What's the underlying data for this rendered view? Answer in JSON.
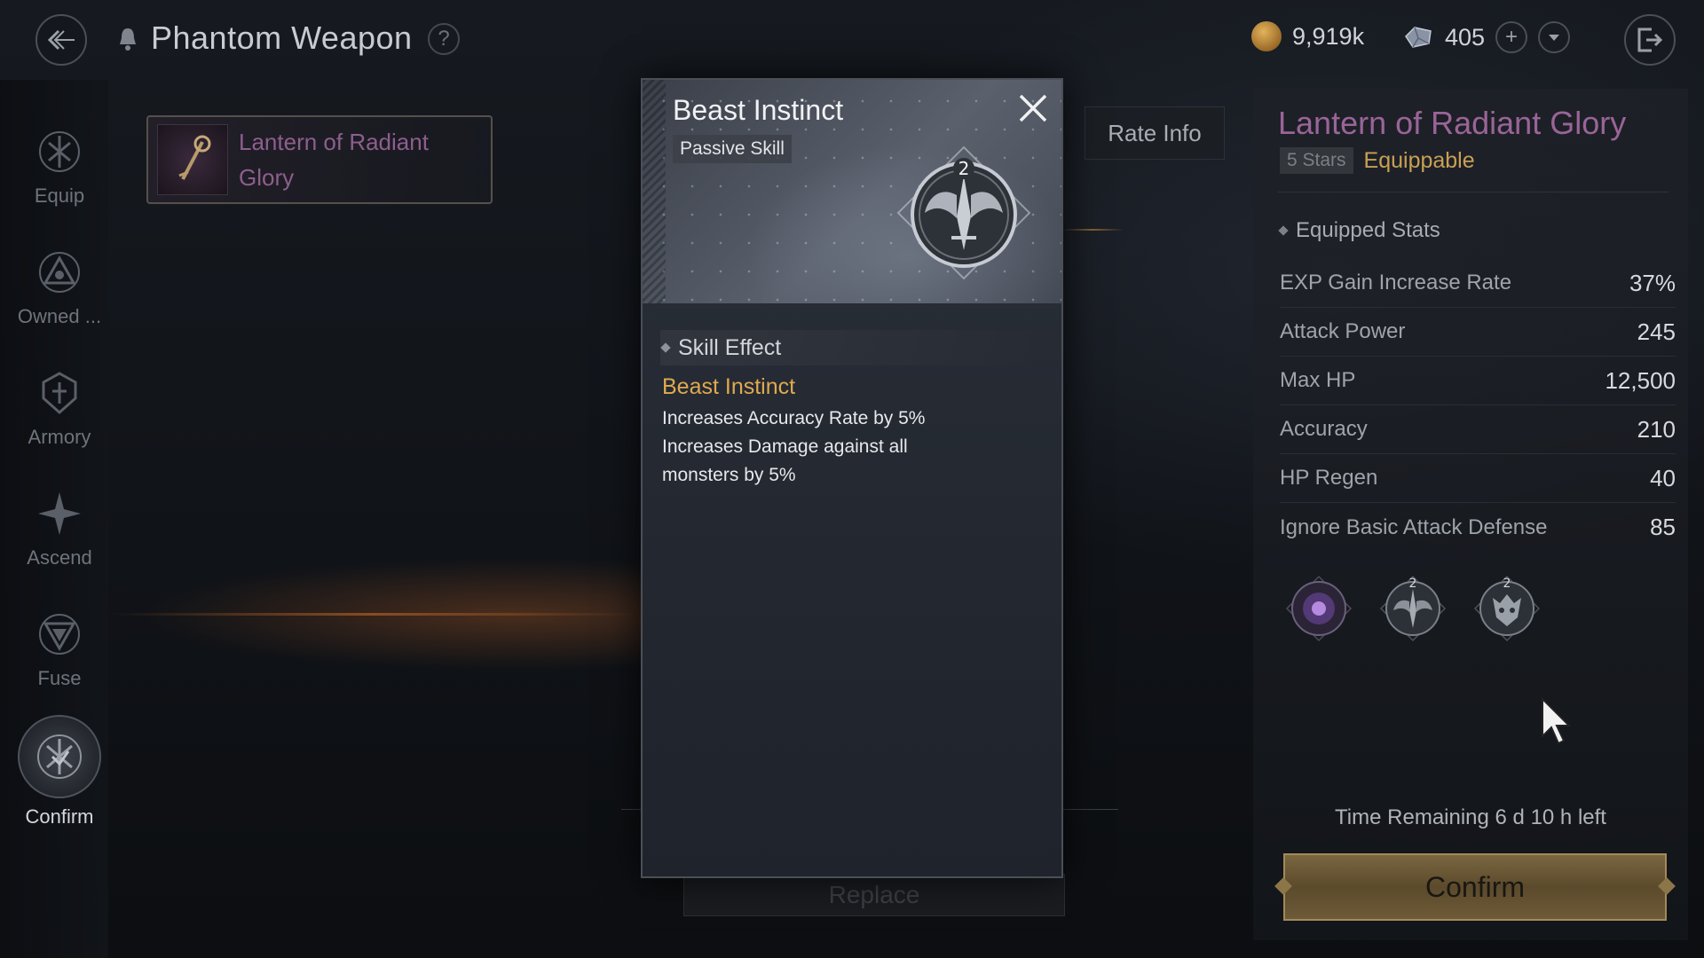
{
  "header": {
    "title": "Phantom Weapon",
    "help": "?",
    "currencies": [
      {
        "icon": "gold-coin-icon",
        "value": "9,919k"
      },
      {
        "icon": "crystal-icon",
        "value": "405"
      }
    ]
  },
  "sidebar": {
    "items": [
      {
        "label": "Equip",
        "icon": "equip-icon"
      },
      {
        "label": "Owned ...",
        "icon": "owned-icon"
      },
      {
        "label": "Armory",
        "icon": "armory-icon"
      },
      {
        "label": "Ascend",
        "icon": "ascend-icon"
      },
      {
        "label": "Fuse",
        "icon": "fuse-icon"
      },
      {
        "label": "Confirm",
        "icon": "confirm-icon",
        "active": true
      }
    ]
  },
  "weapon_card": {
    "name": "Lantern of Radiant Glory"
  },
  "background_button": "Replace",
  "modal": {
    "title": "Beast Instinct",
    "type": "Passive Skill",
    "level": "2",
    "section": "Skill Effect",
    "effect_name": "Beast Instinct",
    "effect_lines": [
      "Increases Accuracy Rate by 5%",
      "Increases Damage against all\nmonsters by 5%"
    ]
  },
  "rate_info": "Rate Info",
  "right_panel": {
    "title": "Lantern of Radiant Glory",
    "stars": "5 Stars",
    "status": "Equippable",
    "section": "Equipped Stats",
    "stats": [
      {
        "name": "EXP Gain Increase Rate",
        "value": "37%"
      },
      {
        "name": "Attack Power",
        "value": "245"
      },
      {
        "name": "Max HP",
        "value": "12,500"
      },
      {
        "name": "Accuracy",
        "value": "210"
      },
      {
        "name": "HP Regen",
        "value": "40"
      },
      {
        "name": "Ignore Basic Attack Defense",
        "value": "85"
      }
    ],
    "skills": [
      {
        "icon": "purple-orb-skill-icon",
        "level": ""
      },
      {
        "icon": "beast-instinct-skill-icon",
        "level": "2"
      },
      {
        "icon": "beast-face-skill-icon",
        "level": "2"
      }
    ],
    "time_remaining": "Time Remaining 6 d 10 h left",
    "confirm_label": "Confirm"
  },
  "colors": {
    "accent_gold": "#e0aa4e",
    "weapon_purple": "#9a6498",
    "confirm_bg": "#6d5a37"
  }
}
